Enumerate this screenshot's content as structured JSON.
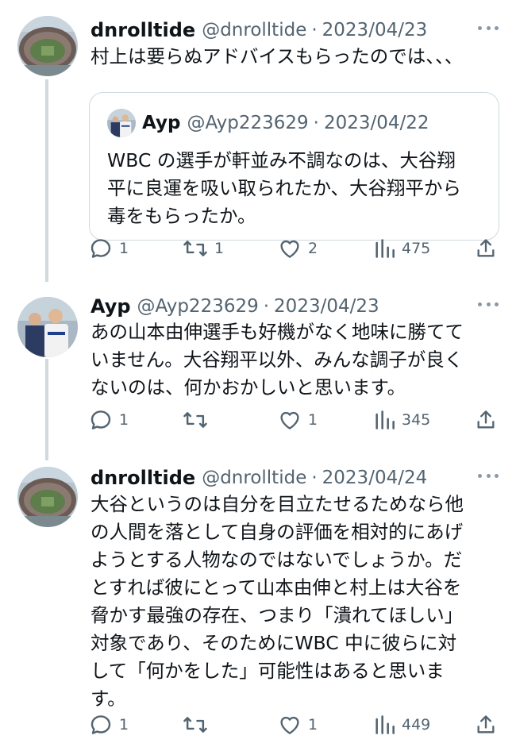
{
  "tweets": [
    {
      "name": "dnrolltide",
      "handle": "@dnrolltide",
      "separator": "·",
      "date": "2023/04/23",
      "lines": [
        "村上は要らぬアドバイスもらったのでは、、、"
      ],
      "quote": {
        "name": "Ayp",
        "handle": "@Ayp223629",
        "separator": "·",
        "date": "2023/04/22",
        "lines": [
          "WBC の選手が軒並み不調なのは、大谷翔",
          "平に良運を吸い取られたか、大谷翔平から",
          "毒をもらったか。"
        ]
      },
      "replies": "1",
      "retweets": "1",
      "likes": "2",
      "views": "475"
    },
    {
      "name": "Ayp",
      "handle": "@Ayp223629",
      "separator": "·",
      "date": "2023/04/23",
      "lines": [
        "あの山本由伸選手も好機がなく地味に勝てて",
        "いません。大谷翔平以外、みんな調子が良く",
        "ないのは、何かおかしいと思います。"
      ],
      "replies": "1",
      "retweets": "",
      "likes": "1",
      "views": "345"
    },
    {
      "name": "dnrolltide",
      "handle": "@dnrolltide",
      "separator": "·",
      "date": "2023/04/24",
      "lines": [
        "大谷というのは自分を目立たせるためなら他",
        "の人間を落として自身の評価を相対的にあげ",
        "ようとする人物なのではないでしょうか。だ",
        "とすれば彼にとって山本由伸と村上は大谷を",
        "脅かす最強の存在、つまり「潰れてほしい」",
        "対象であり、そのためにWBC 中に彼らに対",
        "して「何かをした」可能性はあると思いま",
        "す。"
      ],
      "replies": "1",
      "retweets": "",
      "likes": "1",
      "views": "449"
    }
  ],
  "icons": {
    "reply": "reply-icon",
    "retweet": "retweet-icon",
    "like": "heart-icon",
    "views": "views-icon",
    "share": "share-icon",
    "more": "more-icon"
  },
  "colors": {
    "text": "#0f1419",
    "secondary": "#536471",
    "border": "#cfd9de",
    "background": "#ffffff"
  }
}
